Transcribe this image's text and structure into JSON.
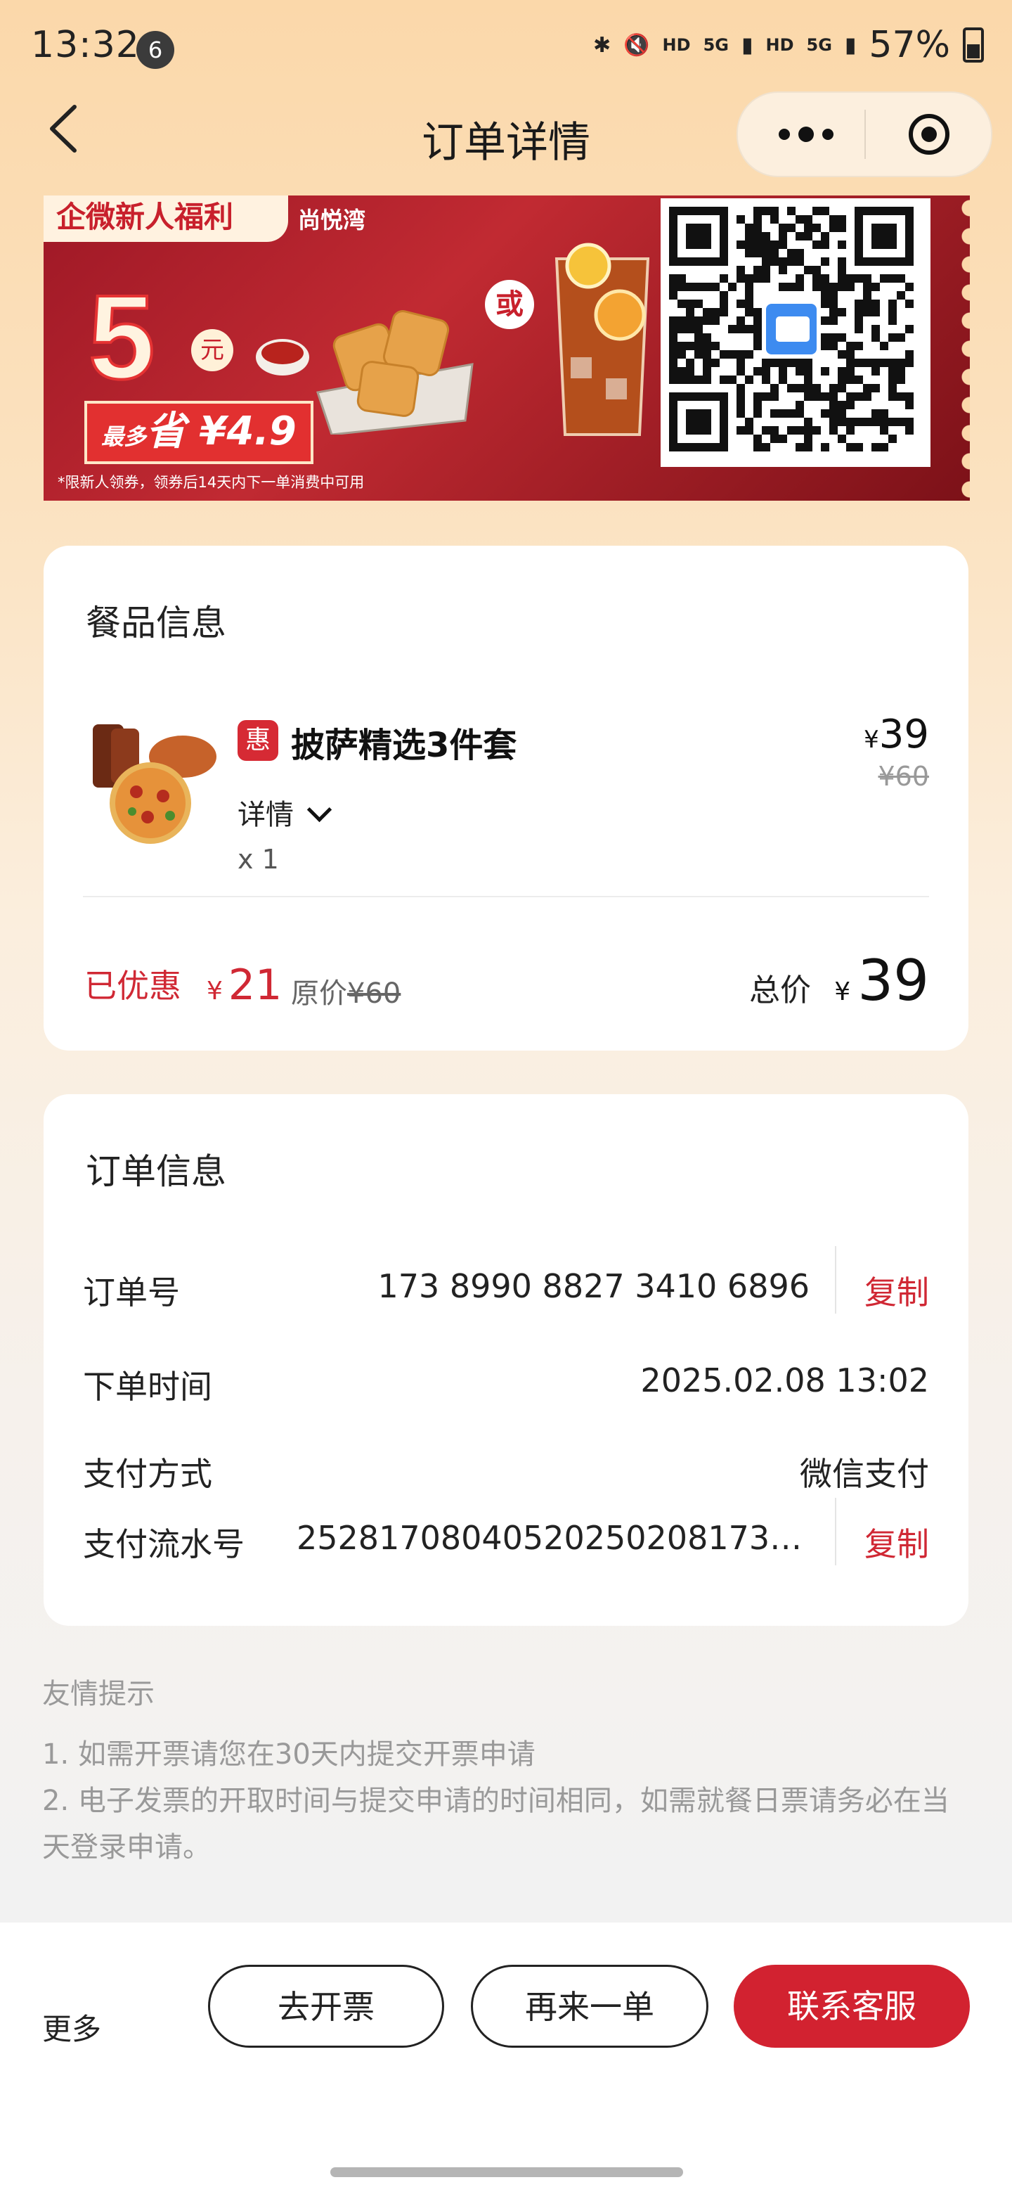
{
  "status_bar": {
    "time": "13:32",
    "notification_count": "6",
    "hd1": "HD",
    "hd2": "HD",
    "net1": "5G",
    "net2": "5G",
    "battery": "57%"
  },
  "nav": {
    "title": "订单详情"
  },
  "banner": {
    "tag": "企微新人福利",
    "shop": "尚悦湾",
    "amount": "5",
    "unit": "元",
    "save_prefix": "最多",
    "save_text": "省 ¥4.9",
    "or_label": "或",
    "note": "*限新人领券，领券后14天内下一单消费中可用"
  },
  "food_section": {
    "title": "餐品信息",
    "item": {
      "badge": "惠",
      "name": "披萨精选3件套",
      "price_symbol": "¥",
      "price": "39",
      "original_price": "¥60",
      "detail_label": "详情",
      "quantity": "x 1"
    },
    "saved_label": "已优惠",
    "saved_symbol": "¥",
    "saved_amount": "21",
    "original_label": "原价",
    "original_total": "¥60",
    "total_label": "总价",
    "total_symbol": "¥",
    "total_amount": "39"
  },
  "order_section": {
    "title": "订单信息",
    "order_no_label": "订单号",
    "order_no": "173 8990 8827 3410 6896",
    "copy_label": "复制",
    "order_time_label": "下单时间",
    "order_time": "2025.02.08 13:02",
    "pay_method_label": "支付方式",
    "pay_method": "微信支付",
    "pay_serial_label": "支付流水号",
    "pay_serial": "25281708040520250208173​8…",
    "copy_label2": "复制"
  },
  "tips": {
    "title": "友情提示",
    "line1": "1. 如需开票请您在30天内提交开票申请",
    "line2": "2. 电子发票的开取时间与提交申请的时间相同，如需就餐日票请务必在当天登录申请。"
  },
  "bottom_bar": {
    "more": "更多",
    "invoice": "去开票",
    "reorder": "再来一单",
    "service": "联系客服"
  },
  "colors": {
    "accent": "#d22230",
    "header_bg": "#fbd8aa"
  }
}
